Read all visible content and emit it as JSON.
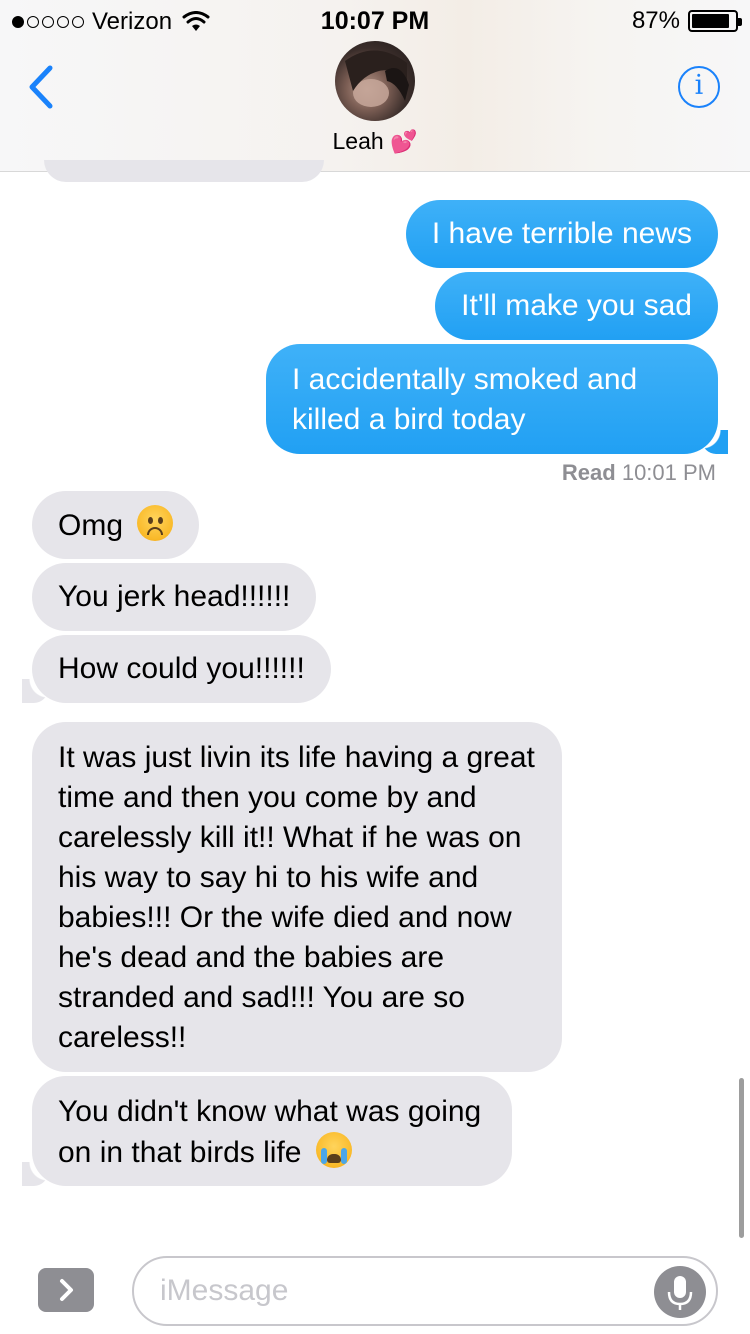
{
  "status_bar": {
    "carrier": "Verizon",
    "time": "10:07 PM",
    "battery": "87%",
    "battery_level": 0.87,
    "signal_bars": 1,
    "signal_total": 5
  },
  "header": {
    "contact_name": "Leah",
    "contact_emoji": "💕",
    "info_label": "i"
  },
  "messages": [
    {
      "side": "sent",
      "text": "I have terrible news"
    },
    {
      "side": "sent",
      "text": "It'll make you sad"
    },
    {
      "side": "sent",
      "text": "I accidentally smoked and killed a bird today"
    },
    {
      "side": "received",
      "text": "Omg",
      "emoji": "frowning-face"
    },
    {
      "side": "received",
      "text": "You jerk head!!!!!!"
    },
    {
      "side": "received",
      "text": "How could you!!!!!!"
    },
    {
      "side": "received",
      "text": "It was just livin its life having a great time and then you come by and carelessly kill it!! What if he was on his way to say hi to his wife and babies!!! Or the wife died and now he's dead and the babies are stranded and sad!!! You are so careless!!"
    },
    {
      "side": "received",
      "text": "You didn't know what was going on in that birds life",
      "emoji": "loudly-crying-face"
    }
  ],
  "read_receipt": {
    "label": "Read",
    "time": "10:01 PM"
  },
  "input": {
    "placeholder": "iMessage"
  },
  "colors": {
    "sent_bubble": "#21a0f3",
    "received_bubble": "#e6e5ea",
    "accent": "#1a82fb"
  },
  "icons": {
    "back": "chevron-left-icon",
    "info": "info-icon",
    "expand": "chevron-right-icon",
    "mic": "microphone-icon",
    "wifi": "wifi-icon",
    "battery": "battery-icon"
  }
}
